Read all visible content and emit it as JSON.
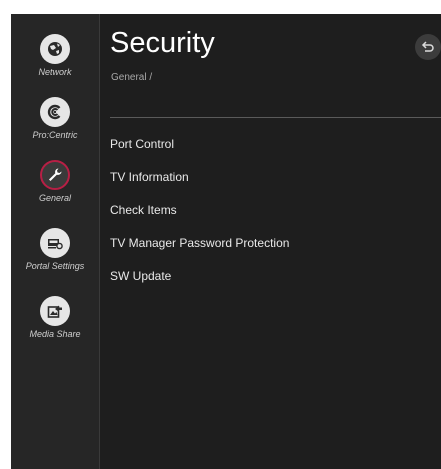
{
  "page": {
    "title": "Security",
    "breadcrumb": "General /"
  },
  "sidebar": {
    "items": [
      {
        "label": "Network",
        "icon": "network-globe-icon"
      },
      {
        "label": "Pro:Centric",
        "icon": "procentric-icon"
      },
      {
        "label": "General",
        "icon": "wrench-icon",
        "active": true
      },
      {
        "label": "Portal Settings",
        "icon": "portal-settings-icon"
      },
      {
        "label": "Media Share",
        "icon": "media-share-icon"
      }
    ]
  },
  "menu": {
    "items": [
      "Port Control",
      "TV Information",
      "Check Items",
      "TV Manager Password Protection",
      "SW Update"
    ]
  },
  "colors": {
    "background": "#1e1e1e",
    "sidebar": "#262626",
    "accent": "#b71f45",
    "text": "#e9e9e9"
  }
}
